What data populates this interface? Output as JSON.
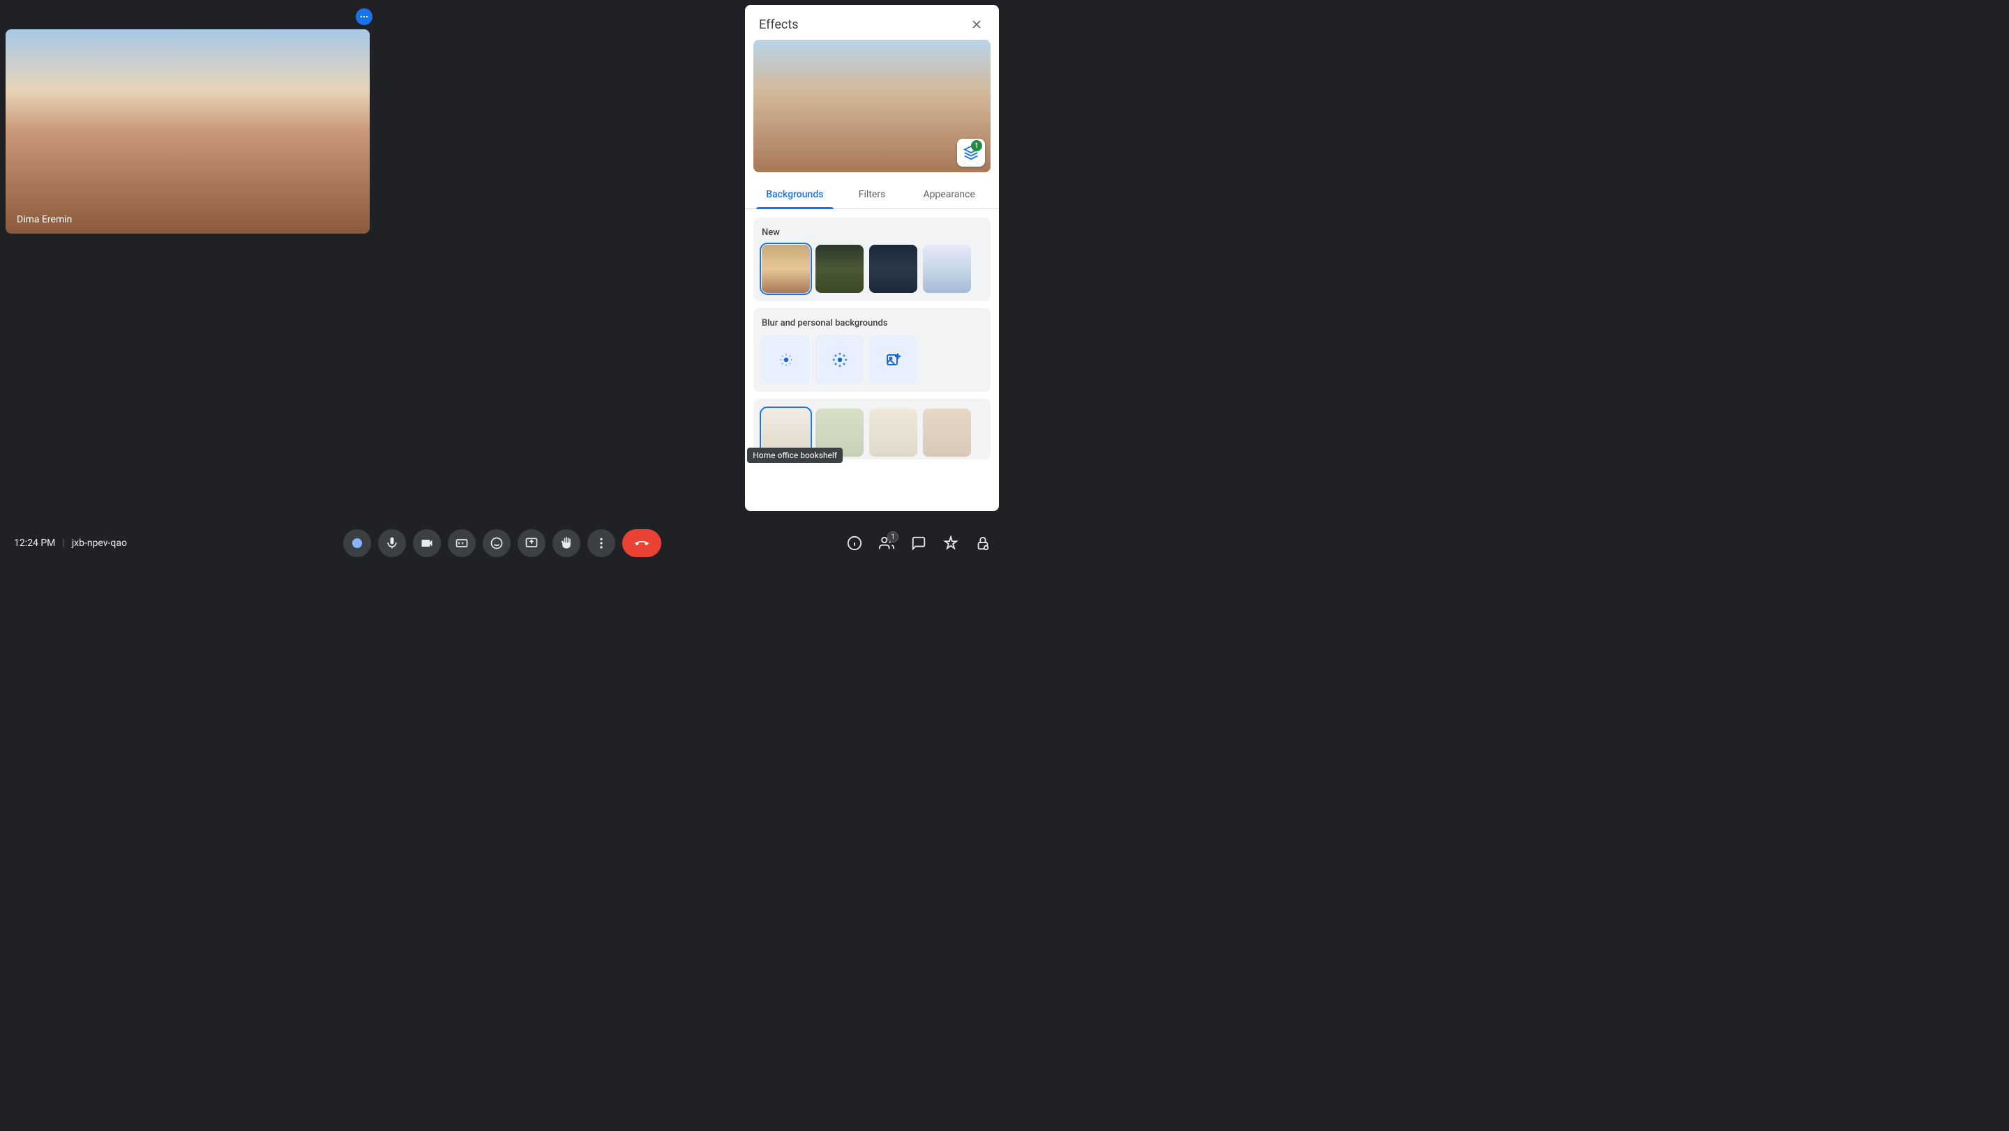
{
  "participant": {
    "name": "Dima Eremin"
  },
  "bottom": {
    "time": "12:24 PM",
    "meeting_code": "jxb-npev-qao",
    "people_count": "1"
  },
  "effects": {
    "title": "Effects",
    "layers_count": "1",
    "tabs": {
      "backgrounds": "Backgrounds",
      "filters": "Filters",
      "appearance": "Appearance"
    },
    "sections": {
      "new": "New",
      "blur": "Blur and personal backgrounds"
    },
    "tooltip": "Home office bookshelf"
  }
}
